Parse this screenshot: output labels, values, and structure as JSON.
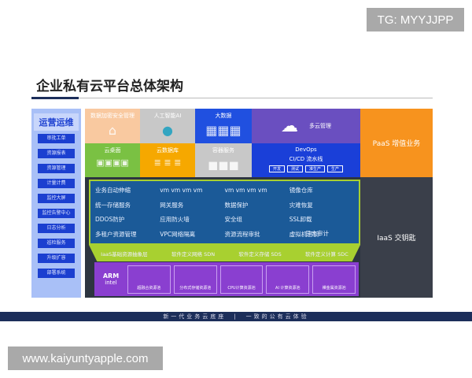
{
  "watermark_top": "TG: MYYJJPP",
  "title": "企业私有云平台总体架构",
  "sidebar": {
    "heading": "运营运维",
    "items": [
      "审批工单",
      "资源报表",
      "资源管理",
      "计量计费",
      "监控大屏",
      "监控告警中心",
      "日志分析",
      "巡检服务",
      "升级扩容",
      "部署系统"
    ]
  },
  "paas": {
    "tiles": [
      "数据加密安全管理",
      "人工智能AI",
      "大数据",
      "多云管理",
      "云桌面",
      "云数据库",
      "容器服务",
      "DevOps"
    ],
    "cicd": "CI/CD 流水线",
    "stages": [
      "开发",
      "测试",
      "准生产",
      "生产"
    ],
    "label": "PaaS 增值业务"
  },
  "iaas": {
    "services": [
      "业务自动伸缩",
      "vm vm vm vm",
      "vm vm vm vm",
      "镜像仓库",
      "统一存储服务",
      "网关服务",
      "数据保护",
      "灾难恢复",
      "DDOS防护",
      "应用防火墙",
      "安全组",
      "SSL卸载",
      "多租户资源管理",
      "VPC网络隔离",
      "资源流程审批",
      "虚拟机密钥"
    ],
    "extra": "日志审计",
    "layer": "IaaS基础资源抽象层",
    "sdn": "软件定义网络 SDN",
    "sds": "软件定义存储 SDS",
    "sdc": "软件定义计算 SDC",
    "chips": [
      "ARM",
      "intel"
    ],
    "pools": [
      "超融合资源池",
      "分布式存储资源池",
      "CPU计算资源池",
      "AI 计算资源池",
      "裸金属资源池"
    ],
    "label": "IaaS 交钥匙"
  },
  "footer": "新一代业务云底座　|　一致的公有云体验",
  "watermark_bottom": "www.kaiyuntyapple.com"
}
